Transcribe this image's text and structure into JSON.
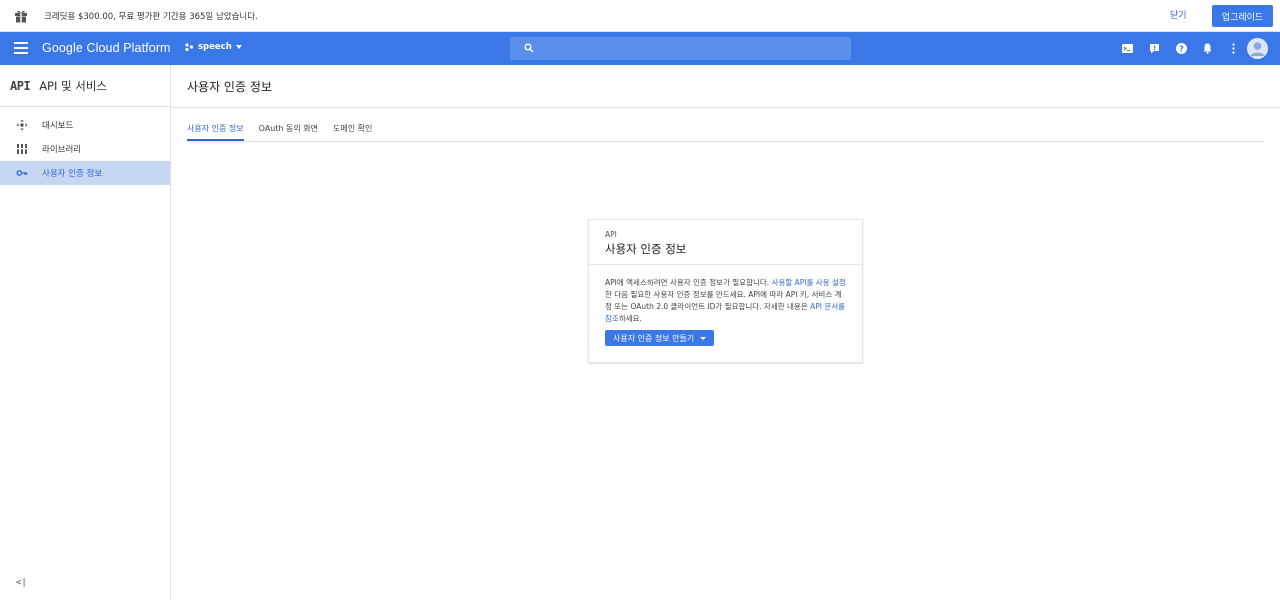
{
  "promo": {
    "text": "크레딧용 $300.00, 무료 평가판 기간용 365일 남았습니다.",
    "close_label": "닫기",
    "upgrade_label": "업그레이드"
  },
  "header": {
    "brand": "Google Cloud Platform",
    "project": "speech",
    "search_placeholder": ""
  },
  "sidebar": {
    "title": "API 및 서비스",
    "api_mark": "API",
    "items": [
      {
        "label": "대시보드",
        "icon": "dashboard-icon"
      },
      {
        "label": "라이브러리",
        "icon": "library-icon"
      },
      {
        "label": "사용자 인증 정보",
        "icon": "key-icon",
        "active": true
      }
    ],
    "collapse_label": "<|"
  },
  "main": {
    "title": "사용자 인증 정보",
    "tabs": [
      {
        "label": "사용자 인증 정보",
        "active": true
      },
      {
        "label": "OAuth 동의 화면"
      },
      {
        "label": "도메인 확인"
      }
    ]
  },
  "card": {
    "subtitle": "API",
    "title": "사용자 인증 정보",
    "body_1": "API에 액세스하려면 사용자 인증 정보가 필요합니다. ",
    "link_1": "사용할 API를 사용 설정",
    "body_2": "한 다음 필요한 사용자 인증 정보를 만드세요. API에 따라 API 키, 서비스 계정 또는 OAuth 2.0 클라이언트 ID가 필요합니다. 자세한 내용은 ",
    "link_2": "API 문서를 참조",
    "body_3": "하세요.",
    "button_label": "사용자 인증 정보 만들기"
  },
  "colors": {
    "primary": "#3b78e7",
    "link": "#3367d6",
    "active_nav_bg": "#c5d7f1"
  }
}
